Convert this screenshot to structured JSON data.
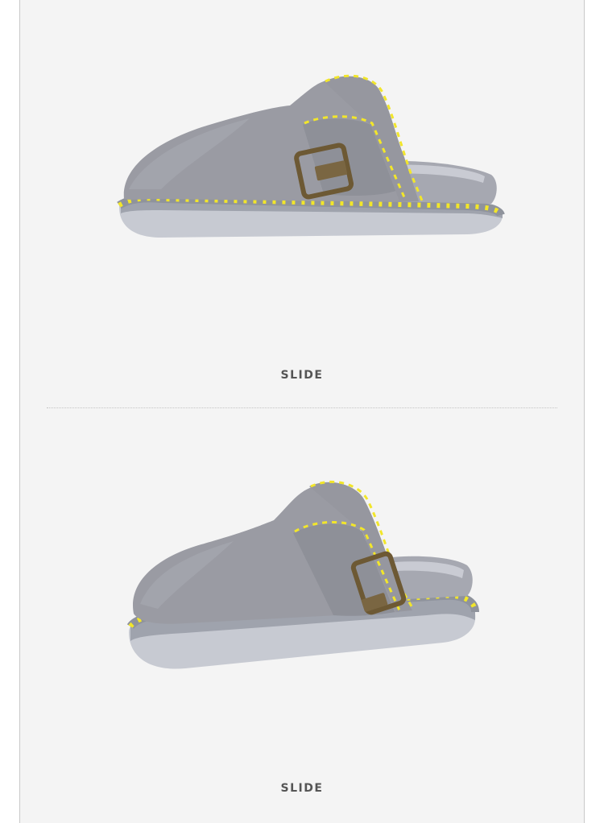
{
  "products": [
    {
      "caption": "SLIDE",
      "image": "grey-suede-clog-side-view",
      "stitch_color": "#f2e62a",
      "suede_color": "#9a9aa2"
    },
    {
      "caption": "SLIDE",
      "image": "grey-suede-clog-angled-view",
      "stitch_color": "#f2e62a",
      "suede_color": "#9a9aa2"
    }
  ],
  "colors": {
    "background": "#f4f4f4",
    "border": "#c9c9c9",
    "caption": "#555555"
  }
}
